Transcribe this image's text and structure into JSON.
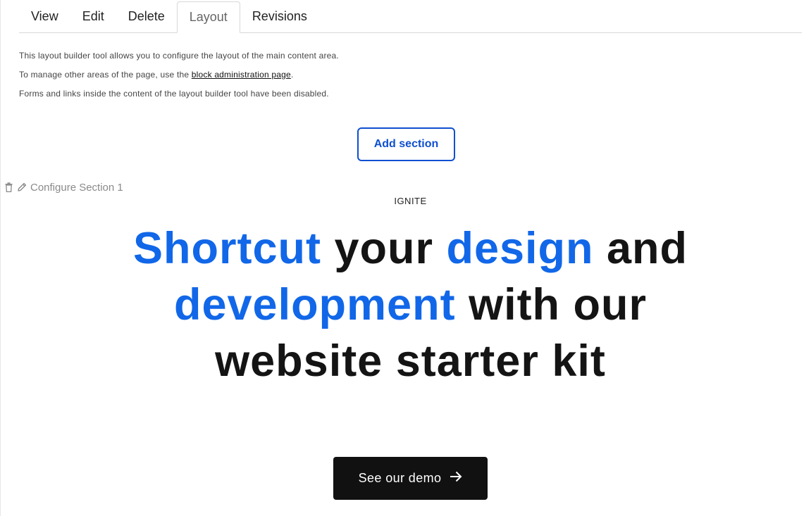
{
  "tabs": [
    {
      "label": "View"
    },
    {
      "label": "Edit"
    },
    {
      "label": "Delete"
    },
    {
      "label": "Layout",
      "active": true
    },
    {
      "label": "Revisions"
    }
  ],
  "info": {
    "line1": "This layout builder tool allows you to configure the layout of the main content area.",
    "line2_prefix": "To manage other areas of the page, use the ",
    "line2_link": "block administration page",
    "line2_suffix": ".",
    "line3": "Forms and links inside the content of the layout builder tool have been disabled."
  },
  "add_section_label": "Add section",
  "configure_section": {
    "label": "Configure Section 1",
    "icons": [
      "trash-icon",
      "pencil-icon"
    ]
  },
  "hero": {
    "eyebrow": "IGNITE",
    "headline_parts": [
      {
        "text": "Shortcut",
        "highlight": true
      },
      {
        "text": " your ",
        "highlight": false
      },
      {
        "text": "design",
        "highlight": true
      },
      {
        "text": " and ",
        "highlight": false
      },
      {
        "text": "development",
        "highlight": true
      },
      {
        "text": " with our website starter kit",
        "highlight": false
      }
    ],
    "button_label": "See our demo",
    "button_icon": "arrow-right-icon"
  },
  "colors": {
    "accent_blue": "#1167e8",
    "button_border_blue": "#0f4fd0",
    "dark_button": "#111111"
  }
}
